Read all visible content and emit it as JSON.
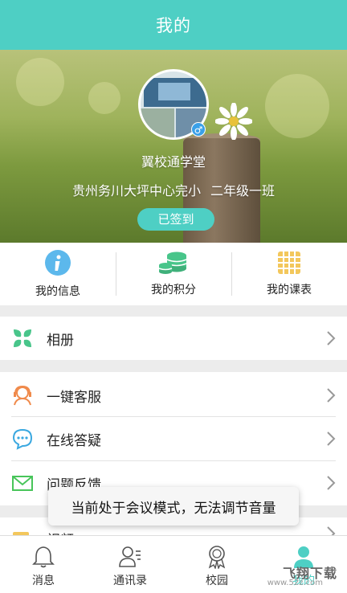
{
  "header": {
    "title": "我的"
  },
  "profile": {
    "school_name": "翼校通学堂",
    "school": "贵州务川大坪中心完小",
    "class": "二年级一班",
    "gender_symbol": "♂",
    "signin_label": "已签到"
  },
  "quick_actions": [
    {
      "label": "我的信息",
      "icon": "info-icon"
    },
    {
      "label": "我的积分",
      "icon": "coins-icon"
    },
    {
      "label": "我的课表",
      "icon": "timetable-icon"
    }
  ],
  "menu": {
    "album": "相册",
    "customer_service": "一键客服",
    "online_qa": "在线答疑",
    "feedback": "问题反馈",
    "video": "视频"
  },
  "toast": "当前处于会议模式，无法调节音量",
  "tabs": [
    {
      "label": "消息"
    },
    {
      "label": "通讯录"
    },
    {
      "label": "校园"
    },
    {
      "label": "我的"
    }
  ],
  "watermark": {
    "brand": "飞翔下载",
    "url": "www.52z.com"
  },
  "colors": {
    "accent": "#4ecfc4",
    "info_blue": "#5cb8ec",
    "coins_green": "#48c58a",
    "timetable_yellow": "#f3c75c"
  }
}
